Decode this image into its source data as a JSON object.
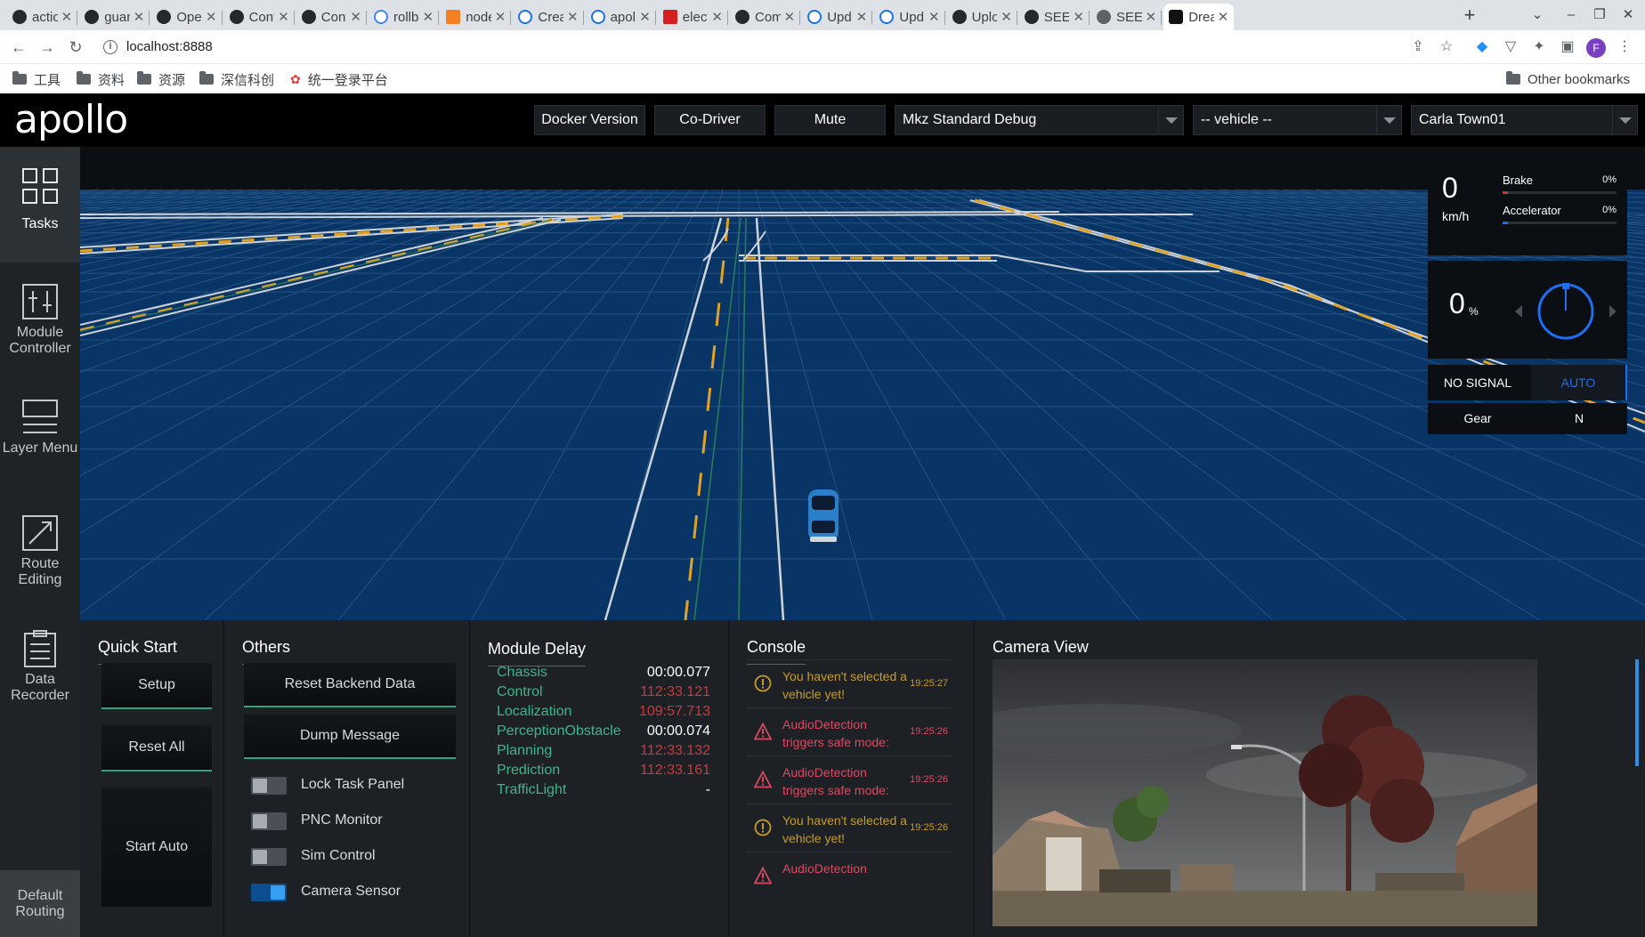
{
  "browser": {
    "tabs": [
      {
        "title": "actio",
        "favicon": "github-icon"
      },
      {
        "title": "guar",
        "favicon": "github-icon"
      },
      {
        "title": "Oper",
        "favicon": "github-icon"
      },
      {
        "title": "Cont",
        "favicon": "github-icon"
      },
      {
        "title": "Cont",
        "favicon": "github-icon"
      },
      {
        "title": "rollb",
        "favicon": "google-icon"
      },
      {
        "title": "node",
        "favicon": "stackoverflow-icon"
      },
      {
        "title": "Crea",
        "favicon": "loading-icon"
      },
      {
        "title": "apol",
        "favicon": "loading-icon"
      },
      {
        "title": "elect",
        "favicon": "red-tab-icon"
      },
      {
        "title": "Com",
        "favicon": "github-icon"
      },
      {
        "title": "Upd",
        "favicon": "loading-icon"
      },
      {
        "title": "Upd",
        "favicon": "loading-icon"
      },
      {
        "title": "Uplo",
        "favicon": "github-icon"
      },
      {
        "title": "SEEI",
        "favicon": "github-icon"
      },
      {
        "title": "SEEI",
        "favicon": "globe-icon"
      },
      {
        "title": "Drea",
        "favicon": "dreamview-icon",
        "active": true
      }
    ],
    "url": "localhost:8888",
    "profile_initial": "F",
    "bookmarks": [
      "工具",
      "资料",
      "资源",
      "深信科创",
      "统一登录平台"
    ],
    "other_bookmarks": "Other bookmarks"
  },
  "app": {
    "logo": "apollo",
    "header": {
      "docker_version": "Docker Version",
      "co_driver": "Co-Driver",
      "mute": "Mute",
      "mode_select": "Mkz Standard Debug",
      "vehicle_select": "-- vehicle --",
      "map_select": "Carla Town01"
    },
    "sidebar": {
      "items": [
        {
          "label": "Tasks",
          "icon": "tasks-grid-icon",
          "active": true
        },
        {
          "label": "Module Controller",
          "icon": "module-controller-icon"
        },
        {
          "label": "Layer Menu",
          "icon": "layer-menu-icon"
        },
        {
          "label": "Route Editing",
          "icon": "route-editing-icon"
        },
        {
          "label": "Data Recorder",
          "icon": "data-recorder-icon"
        }
      ],
      "default_routing": "Default Routing"
    },
    "dashboard": {
      "speed": "0",
      "speed_unit": "km/h",
      "brake_label": "Brake",
      "brake_pct": "0%",
      "brake_level": 0,
      "accel_label": "Accelerator",
      "accel_pct": "0%",
      "accel_level": 0,
      "steering": "0",
      "steering_unit": "%",
      "signal": "NO SIGNAL",
      "mode": "AUTO",
      "gear_label": "Gear",
      "gear": "N",
      "colors": {
        "brake": "#c93b3b",
        "accel": "#1e6ff0",
        "mode": "#1e6ff0"
      }
    },
    "quick_start": {
      "title": "Quick Start",
      "setup": "Setup",
      "reset_all": "Reset All",
      "start_auto": "Start Auto"
    },
    "others": {
      "title": "Others",
      "reset_backend": "Reset Backend Data",
      "dump_message": "Dump Message",
      "toggles": [
        {
          "label": "Lock Task Panel",
          "on": false
        },
        {
          "label": "PNC Monitor",
          "on": false
        },
        {
          "label": "Sim Control",
          "on": false
        },
        {
          "label": "Camera Sensor",
          "on": true
        }
      ]
    },
    "module_delay": {
      "title": "Module Delay",
      "rows": [
        {
          "name": "Chassis",
          "value": "00:00.077",
          "alert": false
        },
        {
          "name": "Control",
          "value": "112:33.121",
          "alert": true
        },
        {
          "name": "Localization",
          "value": "109:57.713",
          "alert": true
        },
        {
          "name": "PerceptionObstacle",
          "value": "00:00.074",
          "alert": false
        },
        {
          "name": "Planning",
          "value": "112:33.132",
          "alert": true
        },
        {
          "name": "Prediction",
          "value": "112:33.161",
          "alert": true
        },
        {
          "name": "TrafficLight",
          "value": "-",
          "alert": false
        }
      ]
    },
    "console": {
      "title": "Console",
      "messages": [
        {
          "level": "warn",
          "text": "You haven't selected a vehicle yet!",
          "time": "19:25:27"
        },
        {
          "level": "error",
          "text": "AudioDetection triggers safe mode:",
          "time": "19:25:26"
        },
        {
          "level": "error",
          "text": "AudioDetection triggers safe mode:",
          "time": "19:25:26"
        },
        {
          "level": "warn",
          "text": "You haven't selected a vehicle yet!",
          "time": "19:25:26"
        },
        {
          "level": "error",
          "text": "AudioDetection",
          "time": ""
        }
      ]
    },
    "camera_view": {
      "title": "Camera View"
    }
  }
}
